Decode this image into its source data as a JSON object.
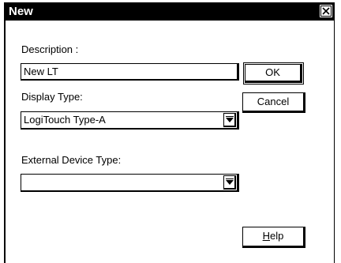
{
  "window": {
    "title": "New"
  },
  "form": {
    "description": {
      "label": "Description :",
      "value": "New LT"
    },
    "display_type": {
      "label": "Display Type:",
      "value": "LogiTouch Type-A"
    },
    "external_device_type": {
      "label": "External Device Type:",
      "value": ""
    }
  },
  "buttons": {
    "ok": "OK",
    "cancel": "Cancel",
    "help_mnemonic": "H",
    "help_rest": "elp"
  },
  "icons": {
    "close": "close-icon",
    "dropdown": "dropdown-arrow-icon"
  }
}
